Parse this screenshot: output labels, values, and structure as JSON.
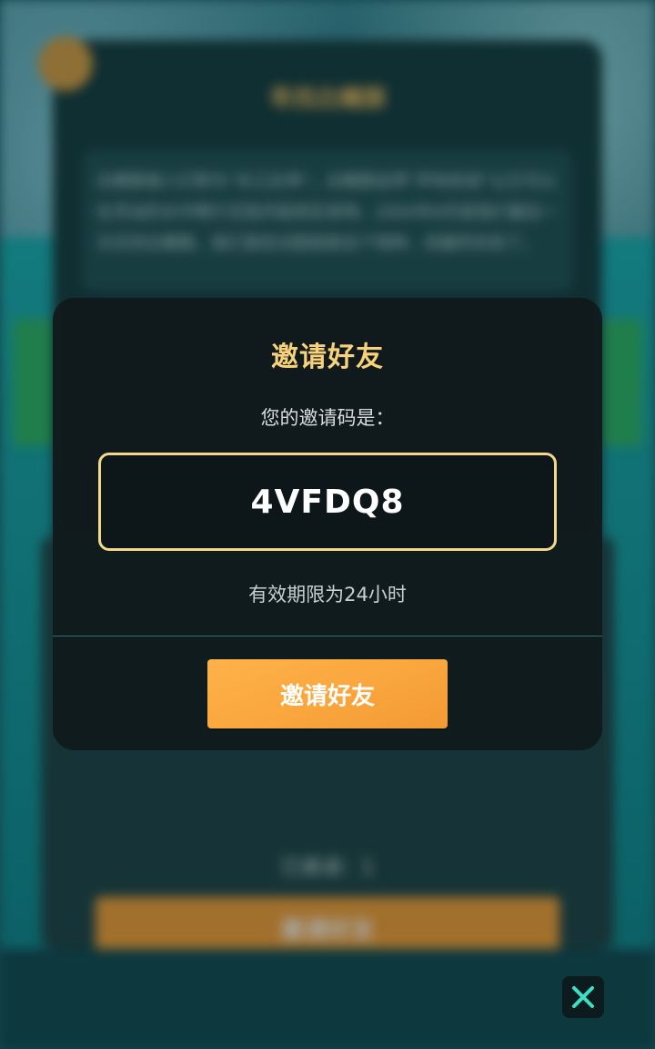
{
  "background": {
    "panel_title": "寻找白鳍豚",
    "panel_description": "白鳍豚被人们称为“长江女神”，白鳍豚由带“声呐系统”让它可以在浑浊的水中畅行无阻并能探定食物。2004年8月是我们最后一次见到白鳍豚。我们曾经试图挽救这个物种，但最终失败了。",
    "status_text": "已邀请：1",
    "bottom_button_label": "邀请好友"
  },
  "dialog": {
    "title": "邀请好友",
    "code_label": "您的邀请码是：",
    "code_value": "4VFDQ8",
    "validity_text": "有效期限为24小时",
    "invite_button_label": "邀请好友"
  },
  "colors": {
    "title": "#f7d27a",
    "code_border": "#f3d88a",
    "button": "#f9a63d",
    "dialog_bg": "#101a1c",
    "divider": "#2b6f78"
  },
  "icons": {
    "close": "close-icon"
  }
}
